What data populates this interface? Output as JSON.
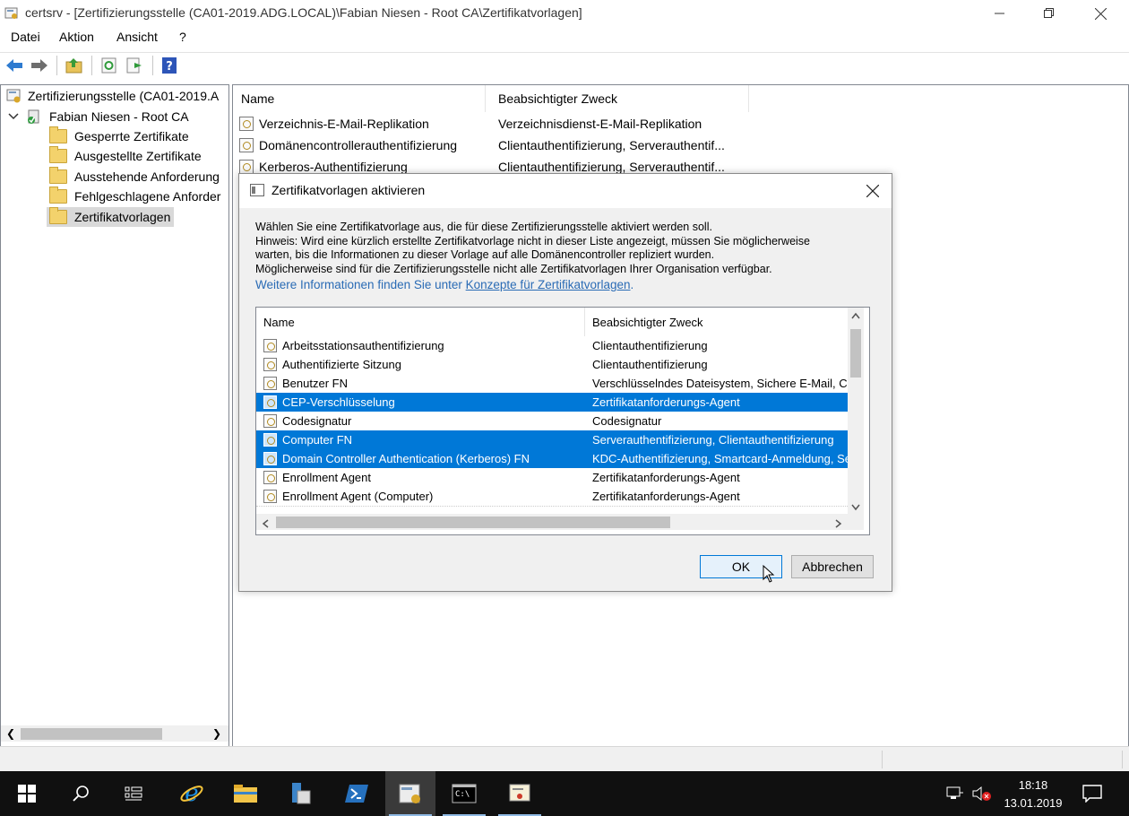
{
  "window": {
    "title": "certsrv - [Zertifizierungsstelle (CA01-2019.ADG.LOCAL)\\Fabian Niesen - Root CA\\Zertifikatvorlagen]",
    "minimize_icon": "minimize-icon",
    "restore_icon": "restore-icon",
    "close_icon": "close-icon"
  },
  "menu": [
    "Datei",
    "Aktion",
    "Ansicht",
    "?"
  ],
  "toolbar": [
    "back-arrow-icon",
    "forward-arrow-icon",
    "up-folder-icon",
    "refresh-icon",
    "export-list-icon",
    "help-icon"
  ],
  "tree": {
    "root": "Zertifizierungsstelle (CA01-2019.A",
    "ca": "Fabian Niesen - Root CA",
    "folders": [
      "Gesperrte Zertifikate",
      "Ausgestellte Zertifikate",
      "Ausstehende Anforderung",
      "Fehlgeschlagene Anforder",
      "Zertifikatvorlagen"
    ],
    "selected": "Zertifikatvorlagen"
  },
  "list": {
    "columns": [
      "Name",
      "Beabsichtigter Zweck"
    ],
    "rows": [
      {
        "name": "Verzeichnis-E-Mail-Replikation",
        "purpose": "Verzeichnisdienst-E-Mail-Replikation"
      },
      {
        "name": "Domänencontrollerauthentifizierung",
        "purpose": "Clientauthentifizierung, Serverauthentif..."
      },
      {
        "name": "Kerberos-Authentifizierung",
        "purpose": "Clientauthentifizierung, Serverauthentif..."
      }
    ]
  },
  "dialog": {
    "title": "Zertifikatvorlagen aktivieren",
    "text_lines": [
      "Wählen Sie eine Zertifikatvorlage aus, die für diese Zertifizierungsstelle aktiviert werden soll.",
      "Hinweis: Wird eine kürzlich erstellte Zertifikatvorlage nicht in dieser Liste angezeigt, müssen Sie möglicherweise",
      "warten, bis die Informationen zu dieser Vorlage auf alle Domänencontroller repliziert wurden.",
      "Möglicherweise sind für die Zertifizierungsstelle nicht alle Zertifikatvorlagen Ihrer Organisation verfügbar."
    ],
    "info_prefix": "Weitere Informationen finden Sie unter ",
    "info_link": "Konzepte für Zertifikatvorlagen",
    "info_suffix": ".",
    "columns": [
      "Name",
      "Beabsichtigter Zweck"
    ],
    "rows": [
      {
        "name": "Arbeitsstationsauthentifizierung",
        "purpose": "Clientauthentifizierung",
        "selected": false
      },
      {
        "name": "Authentifizierte Sitzung",
        "purpose": "Clientauthentifizierung",
        "selected": false
      },
      {
        "name": "Benutzer FN",
        "purpose": "Verschlüsselndes Dateisystem, Sichere E-Mail, C",
        "selected": false
      },
      {
        "name": "CEP-Verschlüsselung",
        "purpose": "Zertifikatanforderungs-Agent",
        "selected": true
      },
      {
        "name": "Codesignatur",
        "purpose": "Codesignatur",
        "selected": false
      },
      {
        "name": "Computer FN",
        "purpose": "Serverauthentifizierung, Clientauthentifizierung",
        "selected": true
      },
      {
        "name": "Domain Controller Authentication (Kerberos) FN",
        "purpose": "KDC-Authentifizierung, Smartcard-Anmeldung, Se",
        "selected": true
      },
      {
        "name": "Enrollment Agent",
        "purpose": "Zertifikatanforderungs-Agent",
        "selected": false
      },
      {
        "name": "Enrollment Agent (Computer)",
        "purpose": "Zertifikatanforderungs-Agent",
        "selected": false
      }
    ],
    "ok": "OK",
    "cancel": "Abbrechen"
  },
  "taskbar": {
    "icons": [
      "start-icon",
      "search-icon",
      "task-view-icon",
      "internet-explorer-icon",
      "file-explorer-icon",
      "server-manager-icon",
      "powershell-icon",
      "certsrv-icon",
      "command-prompt-icon",
      "certificate-app-icon"
    ],
    "time": "18:18",
    "date": "13.01.2019"
  },
  "colors": {
    "selection": "#0078d7",
    "taskbar": "#101010",
    "link": "#2a6bb5"
  }
}
